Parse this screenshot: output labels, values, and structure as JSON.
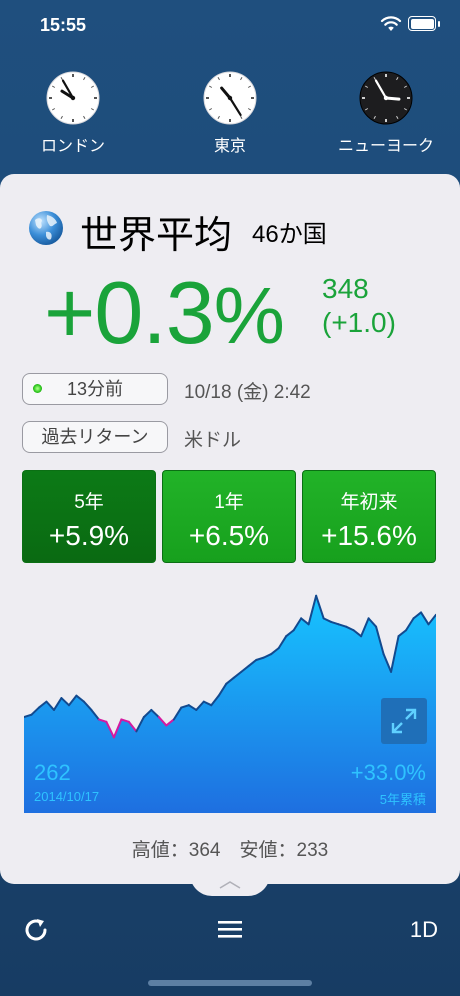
{
  "status_bar": {
    "time": "15:55"
  },
  "clocks": [
    {
      "city": "ロンドン",
      "hour_deg": 302,
      "minute_deg": 330,
      "dark": false
    },
    {
      "city": "東京",
      "hour_deg": 320,
      "minute_deg": 148,
      "dark": false
    },
    {
      "city": "ニューヨーク",
      "hour_deg": 95,
      "minute_deg": 330,
      "dark": true
    }
  ],
  "header": {
    "title": "世界平均",
    "subtitle": "46か国"
  },
  "summary": {
    "change_percent": "+0.3",
    "percent_sign": "%",
    "value": "348",
    "value_change": "(+1.0)"
  },
  "update": {
    "label": "13分前",
    "datetime": "10/18 (金) 2:42"
  },
  "returns": {
    "label": "過去リターン",
    "currency": "米ドル"
  },
  "periods": [
    {
      "label": "5年",
      "value": "+5.9%",
      "active": true
    },
    {
      "label": "1年",
      "value": "+6.5%",
      "active": false
    },
    {
      "label": "年初来",
      "value": "+15.6%",
      "active": false
    }
  ],
  "chart_labels": {
    "start_value": "262",
    "start_date": "2014/10/17",
    "cumulative": "+33.0%",
    "cumulative_label": "5年累積"
  },
  "chart_data": {
    "type": "area",
    "series": [
      {
        "values": [
          262,
          264,
          270,
          275,
          268,
          278,
          272,
          280,
          275,
          268,
          260,
          258,
          245,
          260,
          258,
          250,
          262,
          268,
          262,
          255,
          260,
          270,
          272,
          268,
          275,
          272,
          280,
          290,
          295,
          300,
          305,
          310,
          312,
          315,
          320,
          330,
          335,
          345,
          340,
          364,
          345,
          342,
          340,
          338,
          335,
          330,
          345,
          338,
          315,
          300,
          330,
          335,
          345,
          350,
          340,
          348
        ]
      }
    ]
  },
  "stats": {
    "text": "高値：364　安値：233"
  },
  "toolbar": {
    "range": "1D"
  },
  "colors": {
    "up_green": "#1aa33a",
    "accent_blue": "#2ec3ff"
  }
}
